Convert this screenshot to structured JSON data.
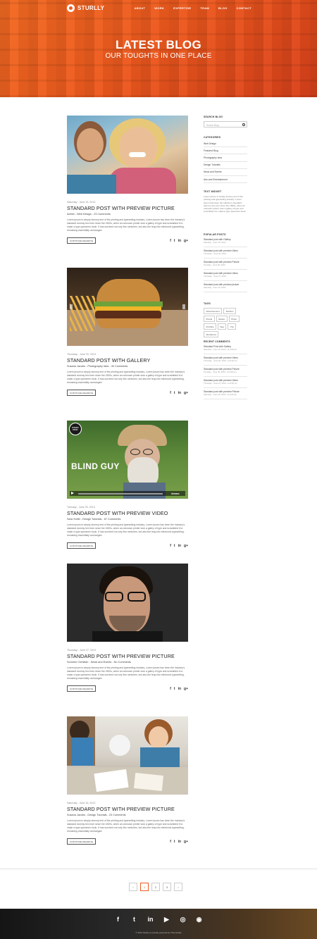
{
  "header": {
    "logo_text": "STURLLY",
    "nav": [
      "ABOUT",
      "WORK",
      "EXPERTISE",
      "TEAM",
      "BLOG",
      "CONTACT"
    ],
    "title": "LATEST BLOG",
    "subtitle": "OUR TOUGHTS IN ONE PLACE"
  },
  "posts": [
    {
      "date": "Saturday - June 15, 2013",
      "title": "STANDARD POST WITH PREVIEW PICTURE",
      "byline": "Admin - Web Design - 23 Comments",
      "excerpt": "Lorem ipsum is simply dummy text of the printing and typesetting industry. Lorem Ipsum has been the industry's standard dummy text ever since the 1500s, when an unknown printer took a galley of type and scrambled it to make a type specimen book. It has survived not only five centuries, but also the leap into electronic typesetting, remaining essentially unchanged.",
      "button": "CONTINUE READING",
      "image": "couple-photo"
    },
    {
      "date": "Thursday - June 20, 2013",
      "title": "STANDARD POST WITH GALLERY",
      "byline": "Susana Jacobs - Photography Idea - 40 Comments",
      "excerpt": "Lorem ipsum is simply dummy text of the printing and typesetting industry. Lorem ipsum has been the industry's standard dummy text ever since the 1500s, when an unknown printer took a galley of type and scrambled it to make a type specimen book. It has survived not only five centuries, but also the leap into electronic typesetting, remaining essentially unchanged.",
      "button": "CONTINUE READING",
      "image": "burger-photo"
    },
    {
      "date": "Tuesday - June 25, 2013",
      "title": "STANDARD POST WITH PREVIEW VIDEO",
      "byline": "Sara Smith - Design Tutorials - 67 Comments",
      "excerpt": "Lorem ipsum is simply dummy text of the printing and typesetting industry. Lorem ipsum has been the industry's standard dummy text ever since the 1500s, when an unknown printer took a galley of type and scrambled it to make a type specimen book. It has survived not only five centuries, but also the leap into electronic typesetting, remaining essentially unchanged.",
      "button": "CONTINUE READING",
      "image": "video-still",
      "video_caption": "BLIND GUY",
      "video_badge": "STAFF PICK",
      "video_brand": "vimeo"
    },
    {
      "date": "Thursday - June 27, 2013",
      "title": "STANDARD POST WITH PREVIEW PICTURE",
      "byline": "Sommer Christian - News and Events - No Comments",
      "excerpt": "Lorem ipsum is simply dummy text of the printing and typesetting industry. Lorem ipsum has been the industry's standard dummy text ever since the 1500s, when an unknown printer took a galley of type and scrambled it to make a type specimen book. It has survived not only five centuries, but also the leap into electronic typesetting, remaining essentially unchanged.",
      "button": "CONTINUE READING",
      "image": "man-glasses-photo"
    },
    {
      "date": "Saturday - June 15, 2013",
      "title": "STANDARD POST WITH PREVIEW PICTURE",
      "byline": "Susana Jacobs - Design Tutorials - 23 Comments",
      "excerpt": "Lorem ipsum is simply dummy text of the printing and typesetting industry. Lorem ipsum has been the industry's standard dummy text ever since the 1500s, when an unknown printer took a galley of type and scrambled it to make a type specimen book. It has survived not only five centuries, but also the leap into electronic typesetting, remaining essentially unchanged.",
      "button": "CONTINUE READING",
      "image": "team-desk-photo"
    }
  ],
  "share_icons": [
    "f",
    "t",
    "in",
    "g+"
  ],
  "sidebar": {
    "search_heading": "SEARCH BLOG",
    "search_placeholder": "Search Blog...",
    "categories_heading": "CATEGORIES",
    "categories": [
      "Web Design",
      "Featured Blog",
      "Photography Idea",
      "Design Tutorials",
      "News and Events",
      "Arts and Entertainment"
    ],
    "text_widget_heading": "TEXT WIDGET",
    "text_widget_body": "Lorem ipsum is simply dummy text of the printing and typesetting industry. Lorem Ipsum has been the industry's standard dummy text ever since the 1500s, when an unknown printer took a galley of type and scrambled it to make a type specimen book.",
    "popular_heading": "POPULAR POSTS",
    "popular": [
      {
        "title": "Standard post with Gallery",
        "date": "Saturday - June 15, 2013"
      },
      {
        "title": "Standard post with preview Video",
        "date": "Thursday - June 20, 2013"
      },
      {
        "title": "Standard post with preview Picture",
        "date": "Tuesday - June 25, 2013"
      },
      {
        "title": "Standard post with preview Video",
        "date": "Thursday - June 27, 2013"
      },
      {
        "title": "Standard post with preview picture",
        "date": "Saturday - June 15, 2013"
      }
    ],
    "tags_heading": "TAGS",
    "tags": [
      "Advertisement",
      "Fashion",
      "Period",
      "Nature",
      "Photo",
      "Portfolio",
      "Sea",
      "Trip",
      "Wordpress"
    ],
    "recent_heading": "RECENT COMMENTS",
    "recent": [
      {
        "title": "Standard Post with Gallery",
        "date": "Saturday - June 15, 2013 - at 4:00 pm"
      },
      {
        "title": "Standard post with preview Video",
        "date": "Thursday - June 20, 2013 - at 2:00 pm"
      },
      {
        "title": "Standard post with preview Picture",
        "date": "Tuesday - June 25, 2013 - at 3:00 pm"
      },
      {
        "title": "Standard post with preview Video",
        "date": "Thursday - June 27, 2013 - at 4:00 pm"
      },
      {
        "title": "Standard post with preview Picture",
        "date": "Saturday - June 15, 2013 - at 4:00 pm"
      }
    ]
  },
  "pagination": {
    "prev": "‹",
    "pages": [
      "1",
      "2",
      "3"
    ],
    "next": "›",
    "active": "1"
  },
  "footer": {
    "icons": [
      "f",
      "twitter",
      "in",
      "You Tube",
      "dribbble",
      "rss"
    ],
    "icon_glyphs": [
      "f",
      "t",
      "in",
      "▶",
      "◎",
      "◉"
    ],
    "copyright": "© 2014 Sturlly is proudly powered by ThemeGlas"
  },
  "colors": {
    "accent": "#ee5a1e",
    "footer_dark": "#1a1a1a"
  }
}
